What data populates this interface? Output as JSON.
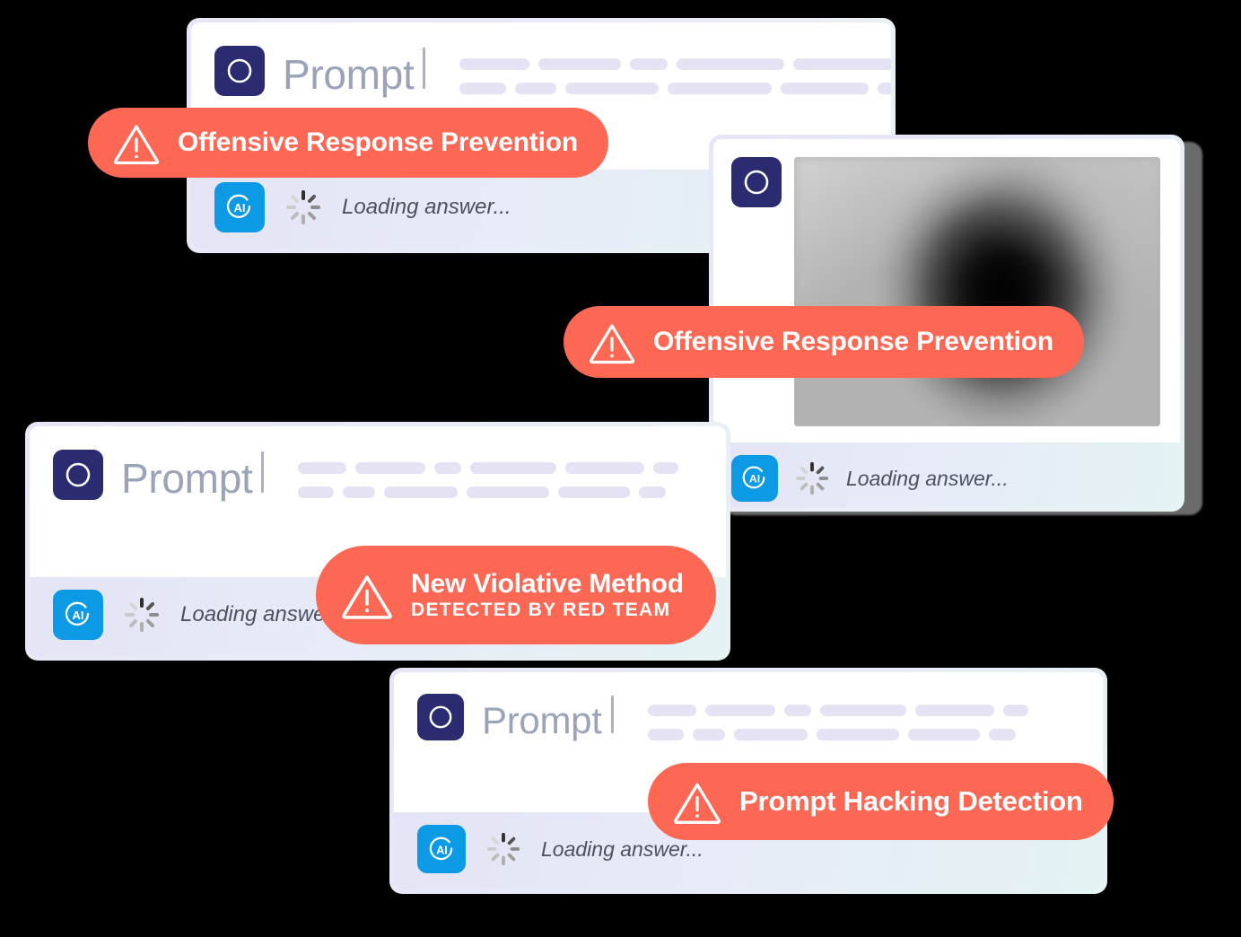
{
  "theme": {
    "background": "#000000",
    "coral": "#fd6854",
    "indigo": "#2b2b72",
    "blue": "#0d9ae5",
    "skeleton": "#e4e2f3",
    "prompt_text": "#9aa3b8"
  },
  "cards": [
    {
      "id": "card-prompt-1",
      "prompt_label": "Prompt",
      "caret": "|",
      "avatar_prompt_icon": "circle-outline-icon",
      "avatar_ai_icon": "ai-circle-icon",
      "avatar_ai_text": "AI",
      "loading_text": "Loading answer...",
      "spinner_icon": "loading-spinner-icon",
      "skeleton_rows": [
        [
          78,
          92,
          42,
          120,
          112,
          34
        ],
        [
          52,
          46,
          104,
          116,
          98,
          40
        ]
      ],
      "has_image": false
    },
    {
      "id": "card-prompt-2",
      "prompt_label": "",
      "caret": "",
      "avatar_prompt_icon": "circle-outline-icon",
      "avatar_ai_icon": "ai-circle-icon",
      "avatar_ai_text": "AI",
      "loading_text": "Loading answer...",
      "spinner_icon": "loading-spinner-icon",
      "skeleton_rows": [],
      "has_image": true,
      "image_alt": "blurred-censored-image"
    },
    {
      "id": "card-prompt-3",
      "prompt_label": "Prompt",
      "caret": "|",
      "avatar_prompt_icon": "circle-outline-icon",
      "avatar_ai_icon": "ai-circle-icon",
      "avatar_ai_text": "AI",
      "loading_text": "Loading answer...",
      "spinner_icon": "loading-spinner-icon",
      "skeleton_rows": [
        [
          54,
          78,
          30,
          96,
          88,
          28
        ],
        [
          40,
          36,
          82,
          92,
          80,
          30
        ]
      ],
      "has_image": false
    },
    {
      "id": "card-prompt-4",
      "prompt_label": "Prompt",
      "caret": "|",
      "avatar_prompt_icon": "circle-outline-icon",
      "avatar_ai_icon": "ai-circle-icon",
      "avatar_ai_text": "AI",
      "loading_text": "Loading answer...",
      "spinner_icon": "loading-spinner-icon",
      "skeleton_rows": [
        [
          54,
          78,
          30,
          96,
          88,
          28
        ],
        [
          40,
          36,
          82,
          92,
          80,
          30
        ]
      ],
      "has_image": false
    }
  ],
  "badges": [
    {
      "id": "badge-offensive-response-prevention-1",
      "title": "Offensive Response Prevention",
      "subtitle": "",
      "icon": "warning-triangle-icon"
    },
    {
      "id": "badge-offensive-response-prevention-2",
      "title": "Offensive Response Prevention",
      "subtitle": "",
      "icon": "warning-triangle-icon"
    },
    {
      "id": "badge-new-violative-method",
      "title": "New Violative Method",
      "subtitle": "DETECTED BY RED TEAM",
      "icon": "warning-triangle-icon"
    },
    {
      "id": "badge-prompt-hacking-detection",
      "title": "Prompt Hacking Detection",
      "subtitle": "",
      "icon": "warning-triangle-icon"
    }
  ]
}
